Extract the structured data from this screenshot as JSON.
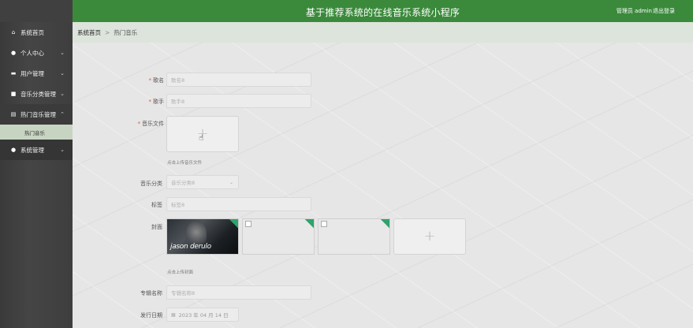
{
  "header": {
    "title": "基于推荐系统的在线音乐系统小程序",
    "user": "管理员 admin",
    "logout": "退出登录"
  },
  "sidebar": {
    "items": [
      {
        "label": "系统首页",
        "icon": "home-icon"
      },
      {
        "label": "个人中心",
        "icon": "user-icon"
      },
      {
        "label": "用户管理",
        "icon": "chat-icon"
      },
      {
        "label": "音乐分类管理",
        "icon": "briefcase-icon"
      },
      {
        "label": "热门音乐管理",
        "icon": "archive-icon"
      },
      {
        "label": "系统管理",
        "icon": "user-icon"
      }
    ],
    "sub_item": "热门音乐"
  },
  "breadcrumb": {
    "home": "系统首页",
    "separator": ">",
    "current": "热门音乐"
  },
  "form": {
    "song_name": {
      "label": "歌名",
      "placeholder": "歌名8"
    },
    "singer": {
      "label": "歌手",
      "placeholder": "歌手8"
    },
    "music_file": {
      "label": "音乐文件",
      "hint": "点击上传音乐文件"
    },
    "category": {
      "label": "音乐分类",
      "value": "音乐分类8"
    },
    "tags": {
      "label": "标签",
      "placeholder": "标签8"
    },
    "cover": {
      "label": "封面",
      "hint": "点击上传封面",
      "photo_caption": "jason derulo"
    },
    "album": {
      "label": "专辑名称",
      "placeholder": "专辑名称8"
    },
    "release_date": {
      "label": "发行日期",
      "value": "2023 年 04 月 14 日"
    }
  },
  "colors": {
    "header_green": "#3b8a3c",
    "sidebar_bg": "#3f3f3f",
    "required": "#e0533a",
    "badge_green": "#2fa36b"
  }
}
